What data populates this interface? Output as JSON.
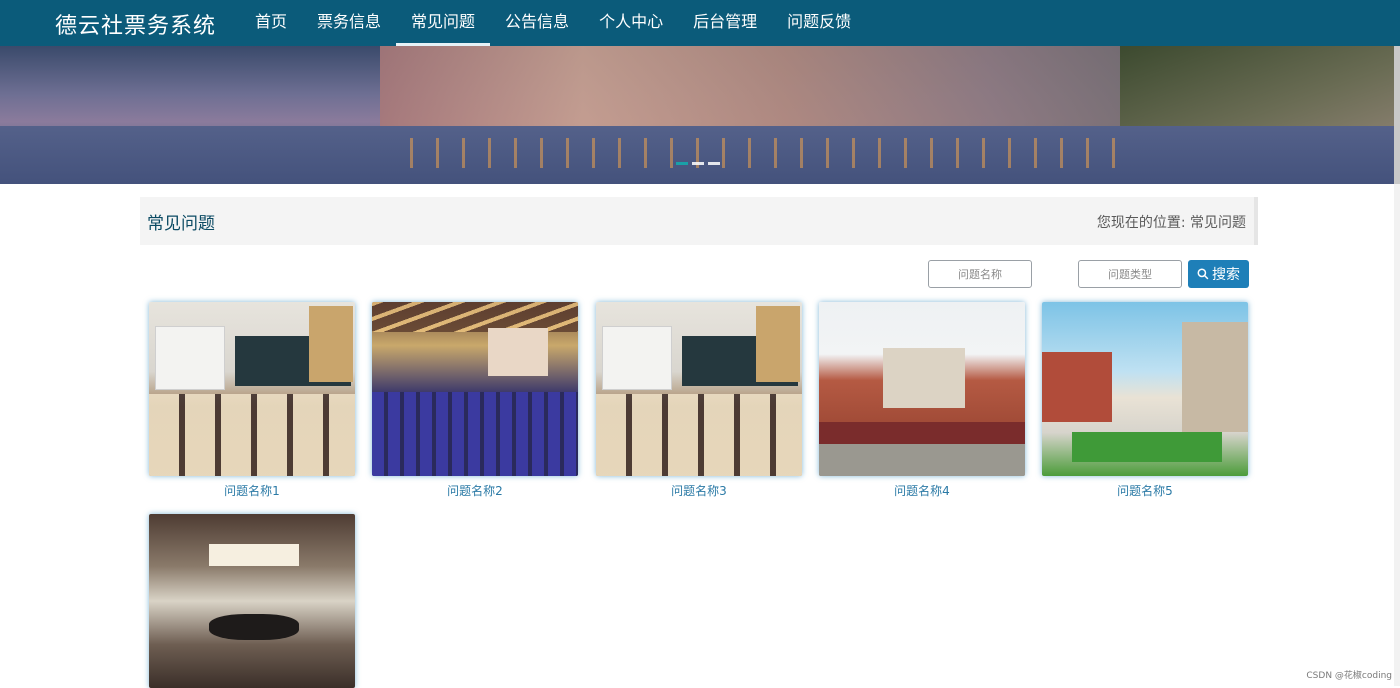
{
  "header": {
    "brand": "德云社票务系统",
    "nav": [
      {
        "label": "首页",
        "active": false
      },
      {
        "label": "票务信息",
        "active": false
      },
      {
        "label": "常见问题",
        "active": true
      },
      {
        "label": "公告信息",
        "active": false
      },
      {
        "label": "个人中心",
        "active": false
      },
      {
        "label": "后台管理",
        "active": false
      },
      {
        "label": "问题反馈",
        "active": false
      }
    ]
  },
  "banner": {
    "slides_total": 3,
    "active_slide": 1
  },
  "section": {
    "title": "常见问题",
    "breadcrumb_prefix": "您现在的位置:",
    "breadcrumb_current": "常见问题"
  },
  "search": {
    "name_placeholder": "问题名称",
    "type_placeholder": "问题类型",
    "button_label": "搜索"
  },
  "cards": [
    {
      "caption": "问题名称1",
      "image": "classroom"
    },
    {
      "caption": "问题名称2",
      "image": "auditorium"
    },
    {
      "caption": "问题名称3",
      "image": "classroom"
    },
    {
      "caption": "问题名称4",
      "image": "campus-building"
    },
    {
      "caption": "问题名称5",
      "image": "campus-courtyard"
    },
    {
      "caption": "",
      "image": "meeting-room"
    }
  ],
  "watermark": "CSDN @花椒coding",
  "colors": {
    "nav_bg": "#0b5b7a",
    "accent": "#1e7fb8",
    "caption": "#2b7aa6"
  }
}
